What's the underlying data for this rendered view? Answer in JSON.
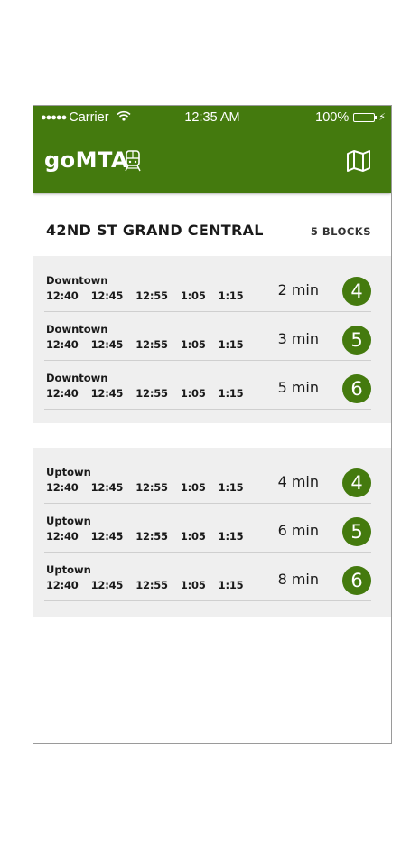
{
  "status_bar": {
    "dots": "●●●●●",
    "carrier": "Carrier",
    "time": "12:35 AM",
    "battery": "100%",
    "battery_level": 1.0
  },
  "app": {
    "title": "goMTA",
    "train_icon": "train-icon",
    "map_icon": "map-icon"
  },
  "station": {
    "name": "42ND ST GRAND CENTRAL",
    "distance": "5 BLOCKS"
  },
  "downtown": [
    {
      "direction": "Downtown",
      "times": [
        "12:40",
        "12:45",
        "12:55",
        "1:05",
        "1:15"
      ],
      "eta": "2 min",
      "line": "4"
    },
    {
      "direction": "Downtown",
      "times": [
        "12:40",
        "12:45",
        "12:55",
        "1:05",
        "1:15"
      ],
      "eta": "3 min",
      "line": "5"
    },
    {
      "direction": "Downtown",
      "times": [
        "12:40",
        "12:45",
        "12:55",
        "1:05",
        "1:15"
      ],
      "eta": "5 min",
      "line": "6"
    }
  ],
  "uptown": [
    {
      "direction": "Uptown",
      "times": [
        "12:40",
        "12:45",
        "12:55",
        "1:05",
        "1:15"
      ],
      "eta": "4 min",
      "line": "4"
    },
    {
      "direction": "Uptown",
      "times": [
        "12:40",
        "12:45",
        "12:55",
        "1:05",
        "1:15"
      ],
      "eta": "6 min",
      "line": "5"
    },
    {
      "direction": "Uptown",
      "times": [
        "12:40",
        "12:45",
        "12:55",
        "1:05",
        "1:15"
      ],
      "eta": "8 min",
      "line": "6"
    }
  ],
  "colors": {
    "brand_green": "#447a0e",
    "group_background": "#efefef",
    "battery_fill": "#7fe241"
  }
}
